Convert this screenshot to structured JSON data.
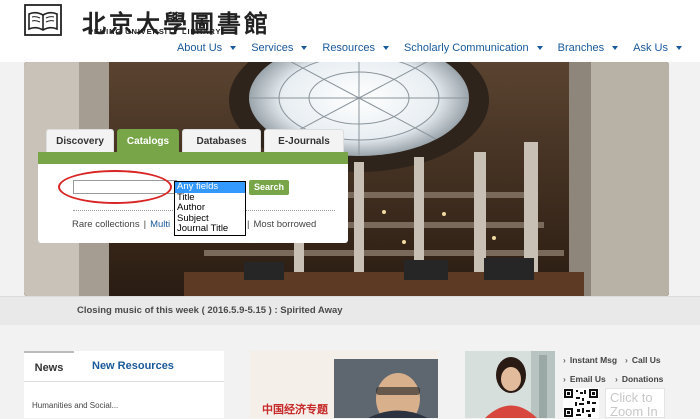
{
  "header": {
    "logo_cn": "北京大學圖書館",
    "logo_en": "PEKING UNIVERSITY LIBRARY"
  },
  "nav": [
    {
      "label": "About Us"
    },
    {
      "label": "Services"
    },
    {
      "label": "Resources"
    },
    {
      "label": "Scholarly Communication"
    },
    {
      "label": "Branches"
    },
    {
      "label": "Ask Us"
    }
  ],
  "search": {
    "tabs": [
      "Discovery",
      "Catalogs",
      "Databases",
      "E-Journals"
    ],
    "active_tab": "Catalogs",
    "input_value": "",
    "button": "Search",
    "dropdown_options": [
      "Any fields",
      "Title",
      "Author",
      "Subject",
      "Journal Title"
    ],
    "selected_option": "Any fields",
    "links": {
      "rare": "Rare collections",
      "multi_visible": "Multi",
      "titles_visible": "itles",
      "most_borrowed": "Most borrowed"
    }
  },
  "ticker": {
    "text": "Closing music of this week ( 2016.5.9-5.15 ) : Spirited Away"
  },
  "news": {
    "tab_news": "News",
    "tab_new_resources": "New Resources",
    "first_item": "Humanities and Social..."
  },
  "feature": {
    "cn_title": "中国经济专题"
  },
  "quick_links": {
    "instant_msg": "Instant Msg",
    "call_us": "Call Us",
    "email_us": "Email Us",
    "donations": "Donations",
    "zoom": "Click to Zoom In"
  },
  "colors": {
    "accent_green": "#77a548",
    "link_blue": "#1a5a9a",
    "annotation_red": "#d92525"
  }
}
